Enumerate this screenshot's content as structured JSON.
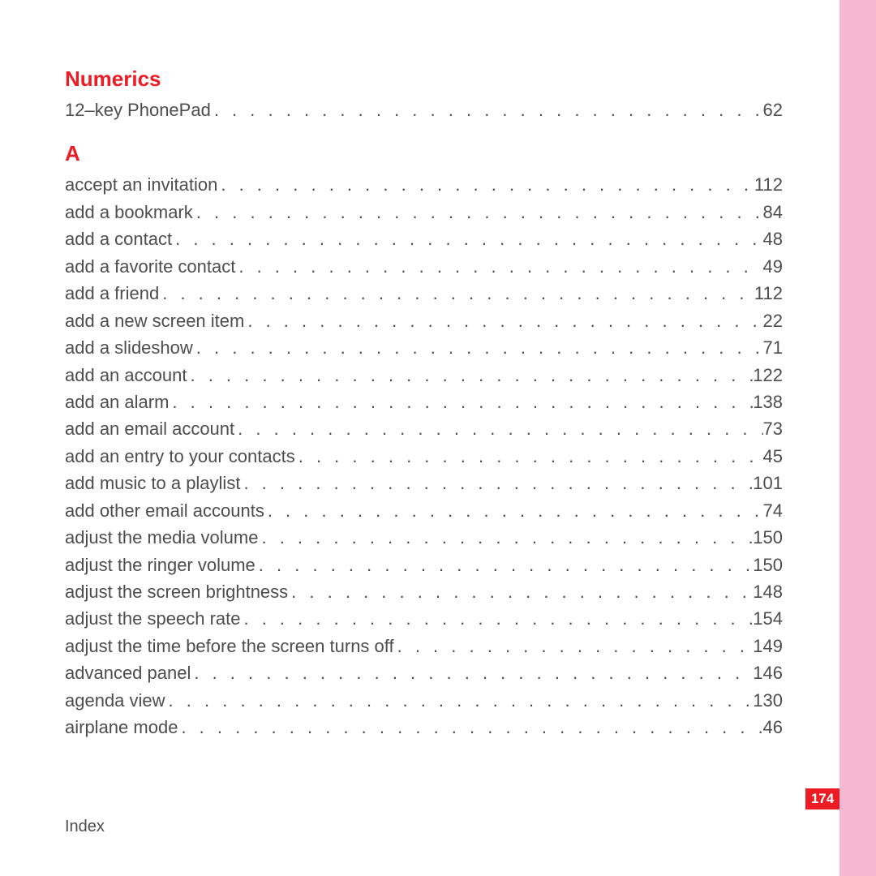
{
  "footer": {
    "label": "Index"
  },
  "pageNumber": "174",
  "dots": ". . . . . . . . . . . . . . . . . . . . . . . . . . . . . . . . . . . . . . . . . . . . . . . . . . . . . . . . . . . . . . . . . . . . . . . . . . . . . . . . . . . . . . . . . . . .",
  "sections": [
    {
      "heading": "Numerics",
      "entries": [
        {
          "term": "12–key PhonePad",
          "page": "62"
        }
      ]
    },
    {
      "heading": "A",
      "entries": [
        {
          "term": "accept an invitation",
          "page": "112"
        },
        {
          "term": "add a bookmark",
          "page": "84"
        },
        {
          "term": "add a contact",
          "page": "48"
        },
        {
          "term": "add a favorite contact",
          "page": "49"
        },
        {
          "term": "add a friend",
          "page": "112"
        },
        {
          "term": "add a new screen item",
          "page": "22"
        },
        {
          "term": "add a slideshow",
          "page": "71"
        },
        {
          "term": "add an account",
          "page": "122"
        },
        {
          "term": "add an alarm",
          "page": "138"
        },
        {
          "term": "add an email account",
          "page": "73"
        },
        {
          "term": "add an entry to your contacts",
          "page": "45"
        },
        {
          "term": "add music to a playlist",
          "page": "101"
        },
        {
          "term": "add other email accounts",
          "page": "74"
        },
        {
          "term": "adjust the media volume",
          "page": "150"
        },
        {
          "term": "adjust the ringer volume",
          "page": "150"
        },
        {
          "term": "adjust the screen brightness",
          "page": "148"
        },
        {
          "term": "adjust the speech rate",
          "page": "154"
        },
        {
          "term": "adjust the time before the screen turns off",
          "page": "149"
        },
        {
          "term": "advanced panel",
          "page": "146"
        },
        {
          "term": "agenda view",
          "page": "130"
        },
        {
          "term": "airplane mode",
          "page": "46"
        }
      ]
    }
  ]
}
